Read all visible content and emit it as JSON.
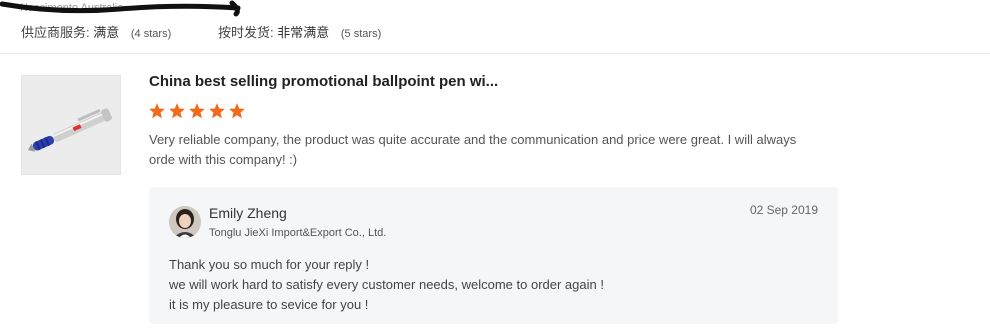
{
  "reviewer": {
    "info": "Nascimento Australia"
  },
  "ratings": [
    {
      "label": "供应商服务:",
      "value": "满意",
      "count": "(4 stars)"
    },
    {
      "label": "按时发货:",
      "value": "非常满意",
      "count": "(5 stars)"
    }
  ],
  "review": {
    "product_title": "China best selling promotional ballpoint pen wi...",
    "stars": 5,
    "star_color": "#f26a1b",
    "text": "Very reliable company, the product was quite accurate and the communication and price were great. I will always orde with this company! :)",
    "thumbnail_icon": "ballpoint-pen-image"
  },
  "reply": {
    "name": "Emily Zheng",
    "company": "Tonglu JieXi Import&Export Co., Ltd.",
    "date": "02 Sep 2019",
    "lines": [
      "Thank you so much for your reply !",
      "we will work hard to satisfy every customer needs,  welcome to order again !",
      "it is my pleasure to sevice for you !"
    ]
  }
}
